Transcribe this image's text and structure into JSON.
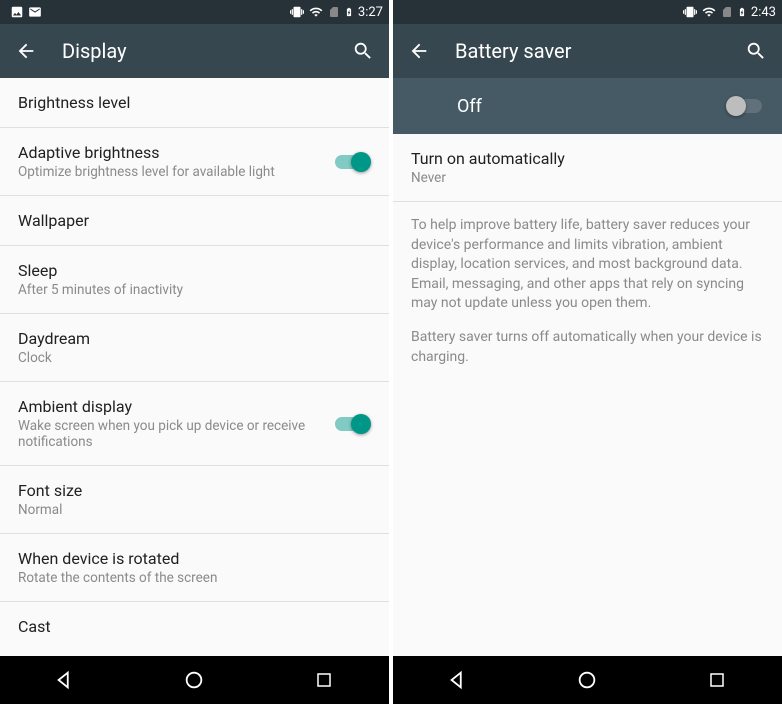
{
  "left": {
    "status": {
      "time": "3:27"
    },
    "toolbar": {
      "title": "Display"
    },
    "items": [
      {
        "title": "Brightness level",
        "sub": ""
      },
      {
        "title": "Adaptive brightness",
        "sub": "Optimize brightness level for available light",
        "toggle": true
      },
      {
        "title": "Wallpaper",
        "sub": ""
      },
      {
        "title": "Sleep",
        "sub": "After 5 minutes of inactivity"
      },
      {
        "title": "Daydream",
        "sub": "Clock"
      },
      {
        "title": "Ambient display",
        "sub": "Wake screen when you pick up device or receive notifications",
        "toggle": true
      },
      {
        "title": "Font size",
        "sub": "Normal"
      },
      {
        "title": "When device is rotated",
        "sub": "Rotate the contents of the screen"
      },
      {
        "title": "Cast",
        "sub": ""
      }
    ]
  },
  "right": {
    "status": {
      "time": "2:43"
    },
    "toolbar": {
      "title": "Battery saver"
    },
    "master": {
      "label": "Off",
      "state": false
    },
    "items": [
      {
        "title": "Turn on automatically",
        "sub": "Never"
      }
    ],
    "info1": "To help improve battery life, battery saver reduces your device's performance and limits vibration, ambient display, location services, and most background data. Email, messaging, and other apps that rely on syncing may not update unless you open them.",
    "info2": "Battery saver turns off automatically when your device is charging."
  }
}
